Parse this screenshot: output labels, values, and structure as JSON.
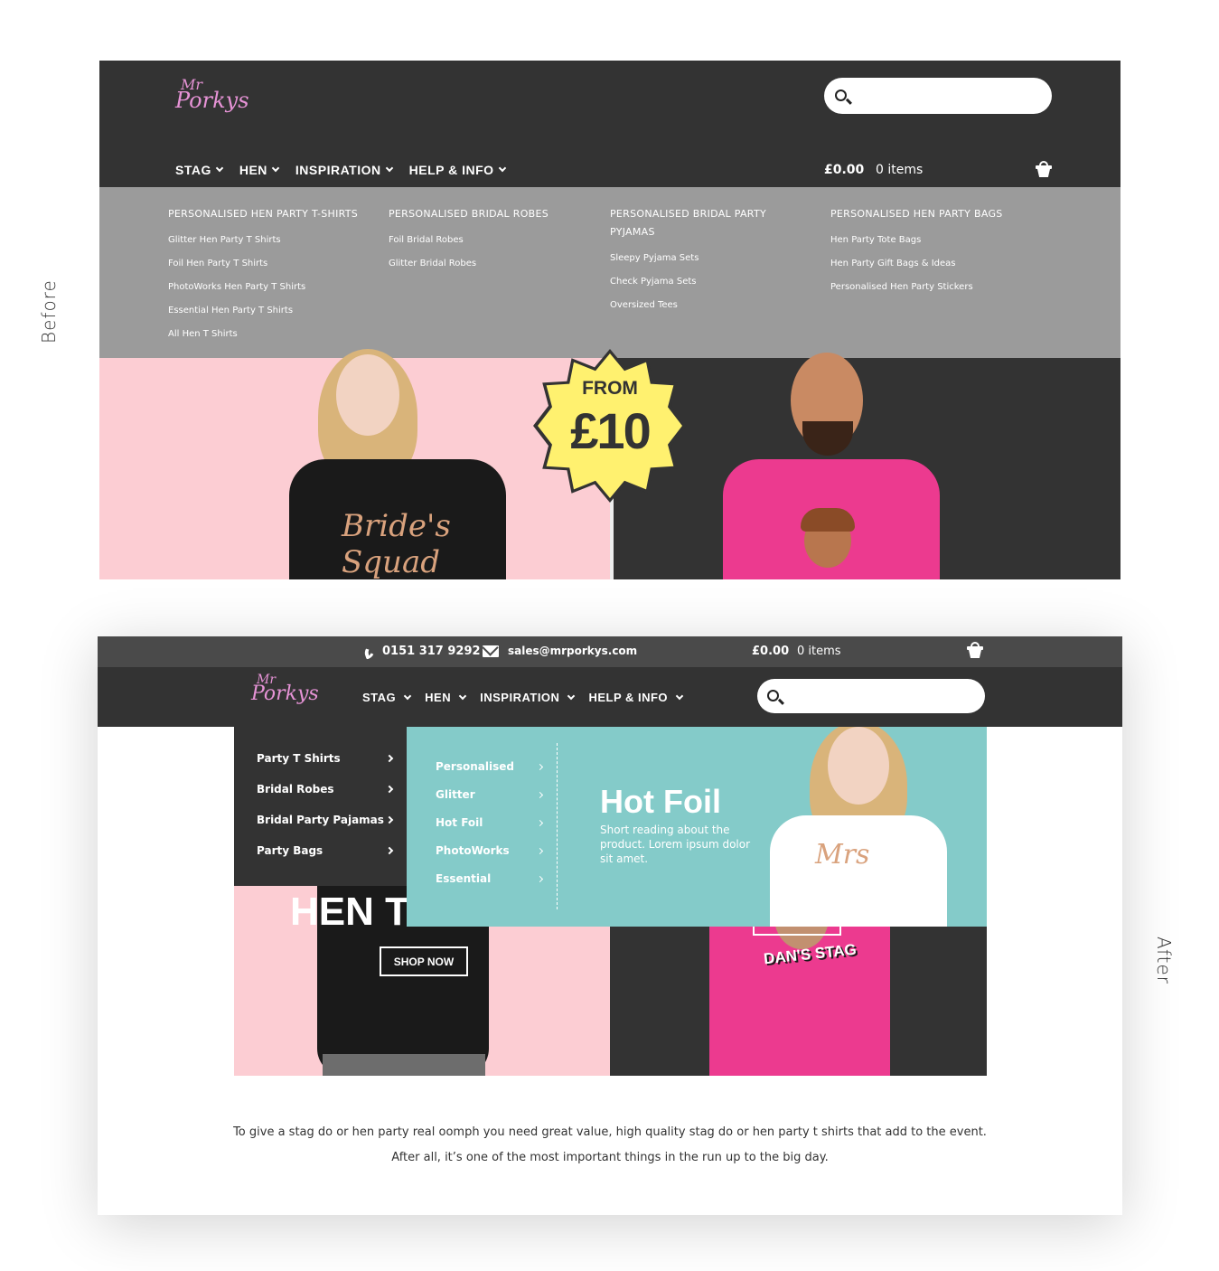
{
  "labels": {
    "before": "Before",
    "after": "After"
  },
  "colors": {
    "dark": "#333333",
    "pink_logo": "#e693d6",
    "mega_grey": "#9b9b9b",
    "teal": "#84cbc9",
    "hero_pink": "#fccdd3",
    "badge_yellow": "#fff16f",
    "shirt_pink": "#ec3a8f"
  },
  "before": {
    "logo": {
      "line1": "Mr",
      "line2": "Porkys"
    },
    "nav": [
      "STAG",
      "HEN",
      "INSPIRATION",
      "HELP & INFO"
    ],
    "cart": {
      "price": "£0.00",
      "items": "0 items"
    },
    "mega_menu": [
      {
        "heading": "PERSONALISED HEN PARTY T-SHIRTS",
        "links": [
          "Glitter Hen Party T Shirts",
          "Foil Hen Party T Shirts",
          "PhotoWorks Hen Party T Shirts",
          "Essential Hen Party T Shirts",
          "All Hen T Shirts"
        ]
      },
      {
        "heading": "PERSONALISED BRIDAL ROBES",
        "links": [
          "Foil Bridal Robes",
          "Glitter Bridal Robes"
        ]
      },
      {
        "heading": "PERSONALISED BRIDAL PARTY PYJAMAS",
        "links": [
          "Sleepy Pyjama Sets",
          "Check Pyjama Sets",
          "Oversized Tees"
        ]
      },
      {
        "heading": "PERSONALISED HEN PARTY BAGS",
        "links": [
          "Hen Party Tote Bags",
          "Hen Party Gift Bags & Ideas",
          "Personalised Hen Party Stickers"
        ]
      }
    ],
    "badge": {
      "line1": "FROM",
      "line2": "£10"
    },
    "shirt_text": "Bride's Squad"
  },
  "after": {
    "topbar": {
      "phone": "0151 317 9292",
      "email": "sales@mrporkys.com",
      "price": "£0.00",
      "items": "0 items"
    },
    "logo": {
      "line1": "Mr",
      "line2": "Porkys"
    },
    "nav": [
      "STAG",
      "HEN",
      "INSPIRATION",
      "HELP & INFO"
    ],
    "menu": [
      "Party T Shirts",
      "Bridal Robes",
      "Bridal Party Pajamas",
      "Party Bags"
    ],
    "submenu": [
      "Personalised",
      "Glitter",
      "Hot Foil",
      "PhotoWorks",
      "Essential"
    ],
    "feature": {
      "title": "Hot Foil",
      "description": "Short reading about the product. Lorem ipsum dolor sit amet.",
      "shirt_text": "Mrs"
    },
    "hero": {
      "hen_text": "HEN T",
      "shop_now": "SHOP NOW",
      "stag_shirt": "DAN'S STAG"
    },
    "intro": [
      "To give a stag do or hen party real oomph you need great value, high quality stag do or hen party t shirts that add to the event.",
      "After all, it’s one of the most important things in the run up to the big day."
    ]
  }
}
